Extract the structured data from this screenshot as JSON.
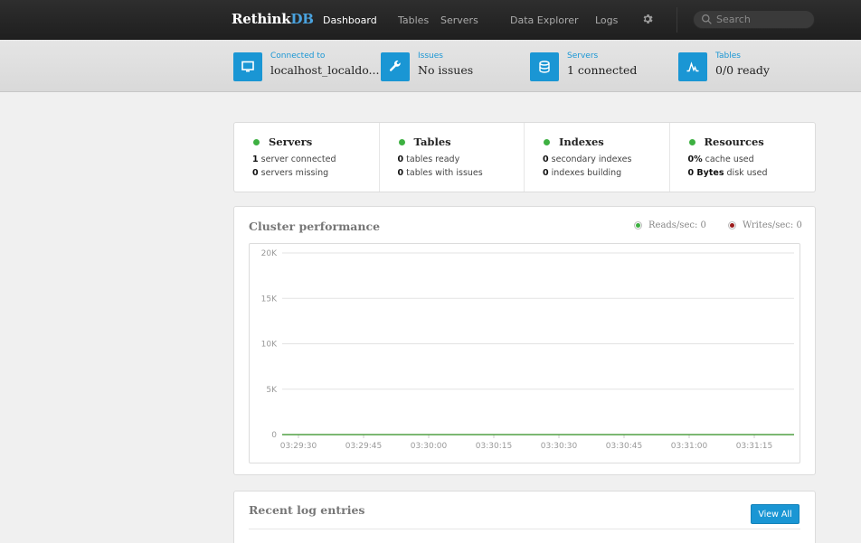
{
  "nav": {
    "brand_a": "Rethink",
    "brand_b": "DB",
    "items": [
      "Dashboard",
      "Tables",
      "Servers",
      "Data Explorer",
      "Logs"
    ],
    "search_placeholder": "Search"
  },
  "status": {
    "connected": {
      "label": "Connected to",
      "value": "localhost_localdo..."
    },
    "issues": {
      "label": "Issues",
      "value": "No issues"
    },
    "servers": {
      "label": "Servers",
      "value": "1 connected"
    },
    "tables": {
      "label": "Tables",
      "value": "0/0 ready"
    }
  },
  "summary": [
    {
      "title": "Servers",
      "lines": [
        {
          "n": "1",
          "t": " server connected"
        },
        {
          "n": "0",
          "t": " servers missing"
        }
      ]
    },
    {
      "title": "Tables",
      "lines": [
        {
          "n": "0",
          "t": " tables ready"
        },
        {
          "n": "0",
          "t": " tables with issues"
        }
      ]
    },
    {
      "title": "Indexes",
      "lines": [
        {
          "n": "0",
          "t": " secondary indexes"
        },
        {
          "n": "0",
          "t": " indexes building"
        }
      ]
    },
    {
      "title": "Resources",
      "lines": [
        {
          "n": "0%",
          "t": " cache used"
        },
        {
          "n": "0 Bytes",
          "t": " disk used"
        }
      ]
    }
  ],
  "performance": {
    "title": "Cluster performance",
    "reads_label": "Reads/sec: 0",
    "writes_label": "Writes/sec: 0"
  },
  "chart_data": {
    "type": "line",
    "title": "Cluster performance",
    "x": [
      "03:29:30",
      "03:29:45",
      "03:30:00",
      "03:30:15",
      "03:30:30",
      "03:30:45",
      "03:31:00",
      "03:31:15"
    ],
    "yticks": [
      "0",
      "5K",
      "10K",
      "15K",
      "20K"
    ],
    "ylim": [
      0,
      20000
    ],
    "series": [
      {
        "name": "Reads/sec: 0",
        "color": "#3db041",
        "values": [
          0,
          0,
          0,
          0,
          0,
          0,
          0,
          0
        ]
      },
      {
        "name": "Writes/sec: 0",
        "color": "#9b1c1c",
        "values": [
          0,
          0,
          0,
          0,
          0,
          0,
          0,
          0
        ]
      }
    ]
  },
  "logs": {
    "title": "Recent log entries",
    "view_all": "View All"
  }
}
